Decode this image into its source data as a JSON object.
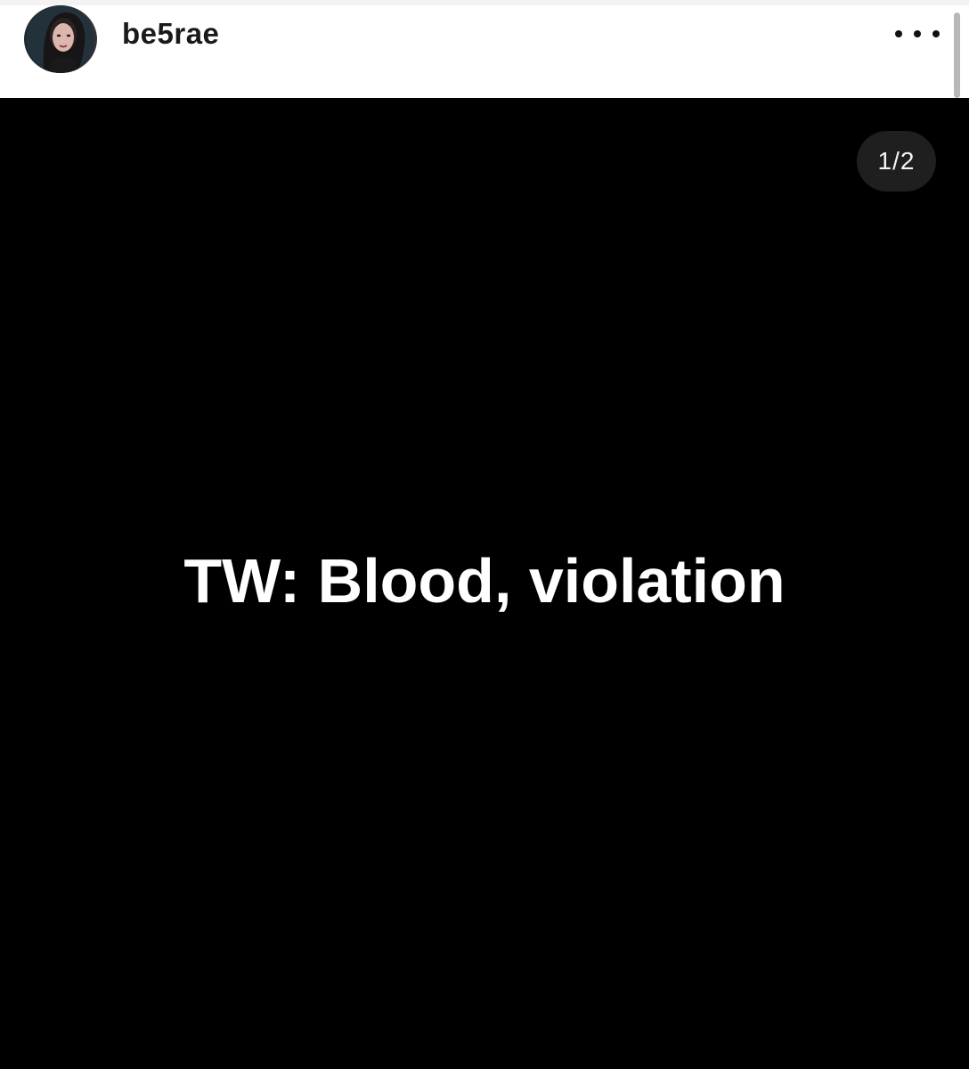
{
  "post": {
    "username": "be5rae",
    "page_counter": "1/2",
    "media_text": "TW: Blood, violation"
  },
  "icons": {
    "avatar": "profile-photo",
    "more": "more-options-ellipsis-icon"
  },
  "colors": {
    "header_bg": "#ffffff",
    "media_bg": "#000000",
    "media_text": "#ffffff",
    "counter_bg": "#1f1f1f"
  }
}
